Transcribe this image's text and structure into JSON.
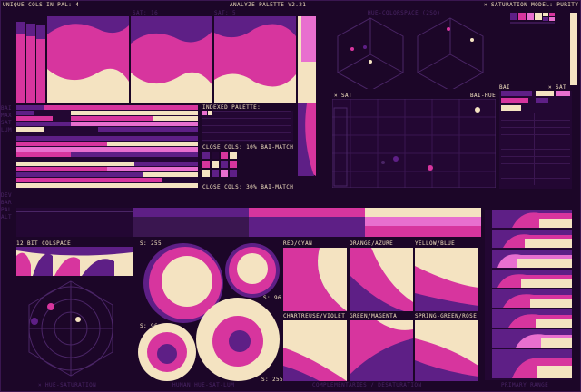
{
  "palette": {
    "cream": "#f4e3c1",
    "magenta": "#d7359e",
    "pink": "#e86fcf",
    "purple": "#5e1f86",
    "deep": "#230733",
    "bg": "#1c0628"
  },
  "header": {
    "unique_cols": "UNIQUE COLS IN PAL: 4",
    "title": "- ANALYZE PALETTE V2.21 -",
    "saturation_model": "× SATURATION MODEL: PURITY",
    "sat_label_1": "SAT: 16",
    "sat_label_2": "SAT: 5",
    "hue_colorspace": "HUE-COLORSPACE (2SO)"
  },
  "indexed": {
    "title": "INDEXED PALETTE:",
    "close_cols_1": "CLOSE COLS: 10% bAI-MATCH",
    "close_cols_2": "CLOSE COLS: 30% bAI-MATCH"
  },
  "scatter": {
    "sat_label": "× SAT",
    "hue_label": "bAI-HUE",
    "bai_label": "bAI",
    "sat_label_right": "× SAT"
  },
  "colspace": {
    "title": "12 bIT COLSPACE",
    "hue_sat_footer": "× HUE-SATURATION"
  },
  "circles": {
    "s_top": "S: 255",
    "s_mid": "S: 96",
    "s_left": "S: 96",
    "s_bottom": "S: 255",
    "footer": "HUMAN HUE-SAT-LUM"
  },
  "complementaries": {
    "items": [
      "RED/CYAN",
      "ORANGE/AZURE",
      "YELLOW/BLUE",
      "CHARTREUSE/VIOLET",
      "GREEN/MAGENTA",
      "SPRING-GREEN/ROSE"
    ],
    "footer": "COMPLEMENTARIES / DESATURATION"
  },
  "primaries": {
    "footer": "PRIMARY RANGE"
  },
  "side_labels": {
    "left_top": [
      "BAI",
      "MAX",
      "SAT",
      "LUM"
    ],
    "left_mid": [
      "DEV",
      "BAR",
      "PAL",
      "ALT"
    ]
  }
}
